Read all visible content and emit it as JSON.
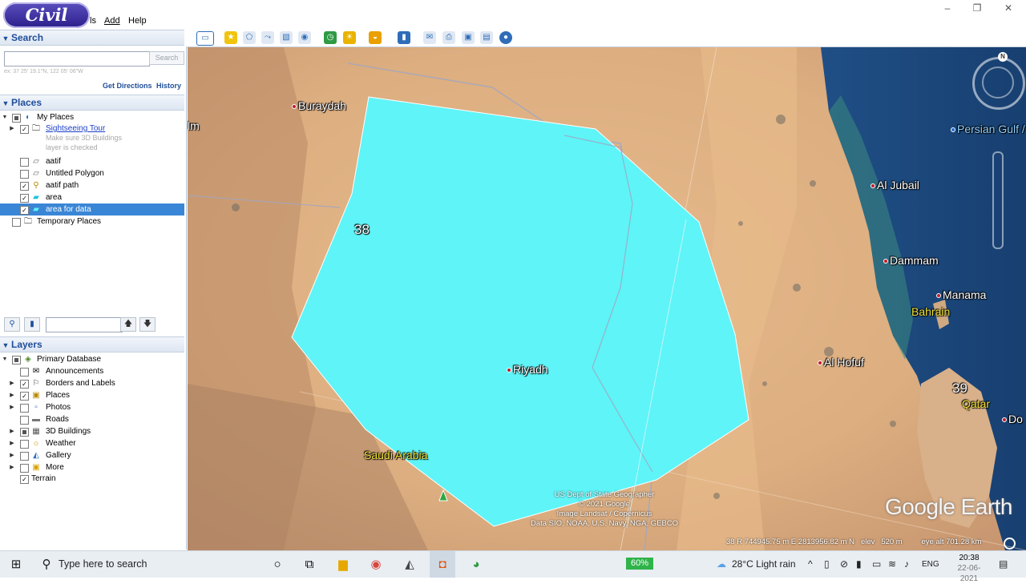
{
  "app": {
    "logo_text": "Civil Soft",
    "menu": [
      "ls",
      "Add",
      "Help"
    ]
  },
  "window_controls": [
    "–",
    "❐",
    "✕"
  ],
  "search": {
    "title": "Search",
    "placeholder": "",
    "button": "Search",
    "hint": "ex: 37 25' 19.1\"N, 122 05' 06\"W",
    "get_directions": "Get Directions",
    "history": "History"
  },
  "places": {
    "title": "Places",
    "items": [
      {
        "label": "My Places",
        "checked": "partial",
        "icon": "my-places-icon"
      },
      {
        "label": "Sightseeing Tour",
        "checked": "checked",
        "icon": "folder-icon",
        "link": true
      },
      {
        "label": "Make sure 3D Buildings",
        "note": true
      },
      {
        "label": "layer is checked",
        "note": true
      },
      {
        "label": "aatif",
        "checked": "unchecked",
        "icon": "polygon-icon"
      },
      {
        "label": "Untitled Polygon",
        "checked": "unchecked",
        "icon": "polygon-icon"
      },
      {
        "label": "aatif path",
        "checked": "checked",
        "icon": "path-icon"
      },
      {
        "label": "area",
        "checked": "checked",
        "icon": "polygon-icon"
      },
      {
        "label": "area for data",
        "checked": "checked",
        "icon": "polygon-icon",
        "selected": true
      },
      {
        "label": "Temporary Places",
        "checked": "unchecked",
        "icon": "folder-icon"
      }
    ]
  },
  "layers": {
    "title": "Layers",
    "items": [
      {
        "label": "Primary Database",
        "checked": "partial"
      },
      {
        "label": "Announcements",
        "checked": "unchecked"
      },
      {
        "label": "Borders and Labels",
        "checked": "checked"
      },
      {
        "label": "Places",
        "checked": "checked"
      },
      {
        "label": "Photos",
        "checked": "unchecked"
      },
      {
        "label": "Roads",
        "checked": "unchecked"
      },
      {
        "label": "3D Buildings",
        "checked": "partial"
      },
      {
        "label": "Weather",
        "checked": "unchecked"
      },
      {
        "label": "Gallery",
        "checked": "unchecked"
      },
      {
        "label": "More",
        "checked": "unchecked"
      },
      {
        "label": "Terrain",
        "checked": "checked"
      }
    ]
  },
  "map": {
    "labels": {
      "buraydah": "Buraydah",
      "im": "lm",
      "persian_gulf": "Persian Gulf /",
      "al_jubail": "Al Jubail",
      "dammam": "Dammam",
      "manama": "Manama",
      "bahrain": "Bahrain",
      "al_hofuf": "Al Hofuf",
      "qatar": "Qatar",
      "do": "Do",
      "riyadh": "Riyadh",
      "saudi_arabia": "Saudi Arabia",
      "zone38": "38",
      "zone39": "39"
    },
    "credits": [
      "US Dept of State Geographer",
      "© 2021 Google",
      "Image Landsat / Copernicus",
      "Data SIO, NOAA, U.S. Navy, NGA, GEBCO"
    ],
    "logo": "Google Earth",
    "status": {
      "coords": "38 R 744945.75 m E 2813956.82 m N",
      "elev_label": "elev",
      "elev": "520 m",
      "eye_alt": "eye alt 701.28 km"
    },
    "compass_n": "N"
  },
  "taskbar": {
    "search_text": "Type here to search",
    "battery": "60%",
    "weather": "28°C  Light rain",
    "language": "ENG",
    "time": "20:38",
    "date": "22-06-2021"
  }
}
